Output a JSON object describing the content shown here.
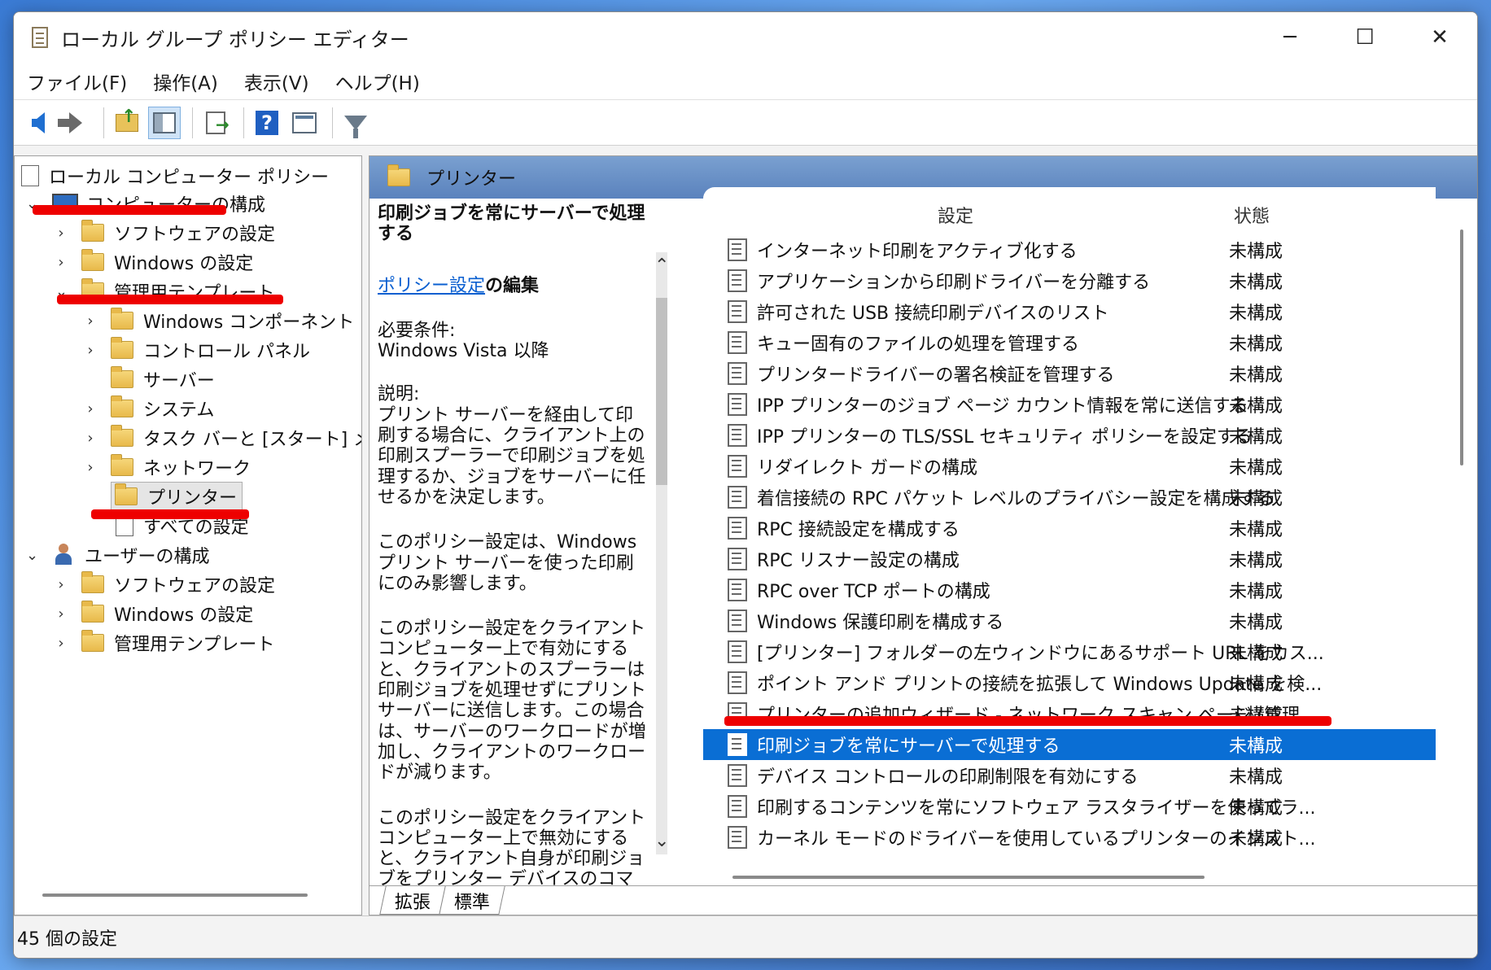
{
  "window": {
    "title": "ローカル グループ ポリシー エディター"
  },
  "menu": [
    "ファイル(F)",
    "操作(A)",
    "表示(V)",
    "ヘルプ(H)"
  ],
  "tree": {
    "root": "ローカル コンピューター ポリシー",
    "computer_config": "コンピューターの構成",
    "software_settings": "ソフトウェアの設定",
    "windows_settings": "Windows の設定",
    "admin_templates": "管理用テンプレート",
    "windows_components": "Windows コンポーネント",
    "control_panel": "コントロール パネル",
    "server": "サーバー",
    "system": "システム",
    "taskbar": "タスク バーと [スタート] メ",
    "network": "ネットワーク",
    "printers": "プリンター",
    "all_settings": "すべての設定",
    "user_config": "ユーザーの構成",
    "user_software_settings": "ソフトウェアの設定",
    "user_windows_settings": "Windows の設定",
    "user_admin_templates": "管理用テンプレート"
  },
  "panel": {
    "folder_title": "プリンター"
  },
  "description": {
    "title": "印刷ジョブを常にサーバーで処理する",
    "edit_link": "ポリシー設定",
    "edit_suffix": "の編集",
    "requirements_label": "必要条件:",
    "requirements_value": "Windows Vista 以降",
    "explanation_label": "説明:",
    "p1": "プリント サーバーを経由して印刷する場合に、クライアント上の印刷スプーラーで印刷ジョブを処理するか、ジョブをサーバーに任せるかを決定します。",
    "p2": "このポリシー設定は、Windows プリント サーバーを使った印刷にのみ影響します。",
    "p3": "このポリシー設定をクライアント コンピューター上で有効にすると、クライアントのスプーラーは印刷ジョブを処理せずにプリント サーバーに送信します。この場合は、サーバーのワークロードが増加し、クライアントのワークロードが減ります。",
    "p4": "このポリシー設定をクライアント コンピューター上で無効にすると、クライアント自身が印刷ジョブをプリンター デバイスのコマンドへと処理します。"
  },
  "list": {
    "col_setting": "設定",
    "col_status": "状態",
    "rows": [
      {
        "name": "インターネット印刷をアクティブ化する",
        "status": "未構成"
      },
      {
        "name": "アプリケーションから印刷ドライバーを分離する",
        "status": "未構成"
      },
      {
        "name": "許可された USB 接続印刷デバイスのリスト",
        "status": "未構成"
      },
      {
        "name": "キュー固有のファイルの処理を管理する",
        "status": "未構成"
      },
      {
        "name": "プリンタードライバーの署名検証を管理する",
        "status": "未構成"
      },
      {
        "name": "IPP プリンターのジョブ ページ カウント情報を常に送信する",
        "status": "未構成"
      },
      {
        "name": "IPP プリンターの TLS/SSL セキュリティ ポリシーを設定する",
        "status": "未構成"
      },
      {
        "name": "リダイレクト ガードの構成",
        "status": "未構成"
      },
      {
        "name": "着信接続の RPC パケット レベルのプライバシー設定を構成する",
        "status": "未構成"
      },
      {
        "name": "RPC 接続設定を構成する",
        "status": "未構成"
      },
      {
        "name": "RPC リスナー設定の構成",
        "status": "未構成"
      },
      {
        "name": "RPC over TCP ポートの構成",
        "status": "未構成"
      },
      {
        "name": "Windows 保護印刷を構成する",
        "status": "未構成"
      },
      {
        "name": "[プリンター] フォルダーの左ウィンドウにあるサポート URL をカス...",
        "status": "未構成"
      },
      {
        "name": "ポイント アンド プリントの接続を拡張して Windows Update を検...",
        "status": "未構成"
      },
      {
        "name": "プリンターの追加ウィザード - ネットワーク スキャン ページ (管理...",
        "status": "未構成"
      },
      {
        "name": "印刷ジョブを常にサーバーで処理する",
        "status": "未構成"
      },
      {
        "name": "デバイス コントロールの印刷制限を有効にする",
        "status": "未構成"
      },
      {
        "name": "印刷するコンテンツを常にソフトウェア ラスタライザーを使ってラ...",
        "status": "未構成"
      },
      {
        "name": "カーネル モードのドライバーを使用しているプリンターのインスト...",
        "status": "未構成"
      }
    ]
  },
  "tabs": [
    "拡張",
    "標準"
  ],
  "status": {
    "count": "45 個の設定"
  }
}
